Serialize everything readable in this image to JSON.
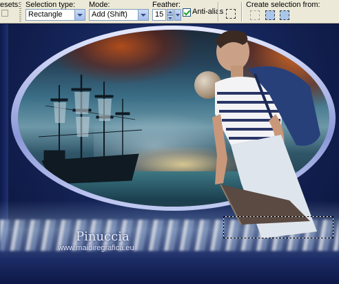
{
  "toolbar": {
    "presets_label": "esets:",
    "selection_type_label": "Selection type:",
    "selection_type_value": "Rectangle",
    "mode_label": "Mode:",
    "mode_value": "Add (Shift)",
    "feather_label": "Feather:",
    "feather_value": "15",
    "antialias_label": "Anti-alias",
    "antialias_checked": true,
    "create_from_label": "Create selection from:"
  },
  "canvas": {
    "watermark_name": "Pinuccia",
    "watermark_url": "www.maidiregrafica.eu"
  }
}
